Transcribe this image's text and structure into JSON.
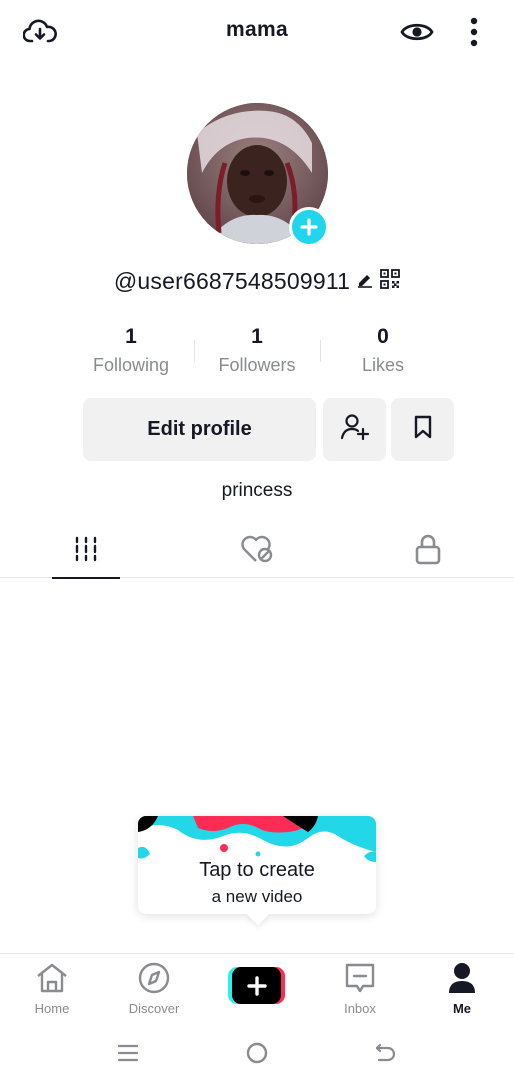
{
  "header": {
    "title": "mama",
    "left_icon": "cloud-download-icon",
    "right_icons": [
      "eye-icon",
      "more-vertical-icon"
    ]
  },
  "profile": {
    "username": "@user6687548509911",
    "bio": "princess",
    "avatar_add_icon": "plus-icon"
  },
  "stats": [
    {
      "value": "1",
      "label": "Following"
    },
    {
      "value": "1",
      "label": "Followers"
    },
    {
      "value": "0",
      "label": "Likes"
    }
  ],
  "actions": {
    "edit_profile": "Edit profile",
    "add_friend_icon": "add-user-icon",
    "bookmark_icon": "bookmark-icon"
  },
  "tabs": [
    {
      "icon": "videos-grid-icon",
      "active": true
    },
    {
      "icon": "liked-heart-icon",
      "active": false
    },
    {
      "icon": "lock-icon",
      "active": false
    }
  ],
  "tooltip": {
    "title": "Tap to create",
    "subtitle": "a new video"
  },
  "bottom_nav": [
    {
      "label": "Home",
      "icon": "home-icon"
    },
    {
      "label": "Discover",
      "icon": "compass-icon"
    },
    {
      "label": "",
      "icon": "create-plus-icon"
    },
    {
      "label": "Inbox",
      "icon": "inbox-icon"
    },
    {
      "label": "Me",
      "icon": "profile-icon",
      "active": true
    }
  ],
  "colors": {
    "accent_cyan": "#25f4ee",
    "accent_red": "#fe2c55",
    "avatar_plus": "#20d5ec",
    "text_primary": "#161823",
    "text_secondary": "#8a8b91"
  }
}
